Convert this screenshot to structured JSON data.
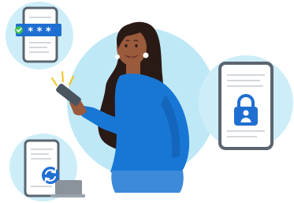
{
  "illustration": {
    "password_mask": "* * *",
    "icons": {
      "check": "check-icon",
      "lock": "lock-person-icon",
      "sync": "sync-icon"
    },
    "colors": {
      "circle_bg": "#cdeef8",
      "main_circle": "#bfe8f6",
      "brand_blue": "#1f6fd1",
      "sweater_blue": "#1877d4",
      "skin": "#9a5a3c",
      "hair": "#2a1a16",
      "phone_frame": "#5b6570",
      "check_green": "#3fbf4f"
    }
  }
}
